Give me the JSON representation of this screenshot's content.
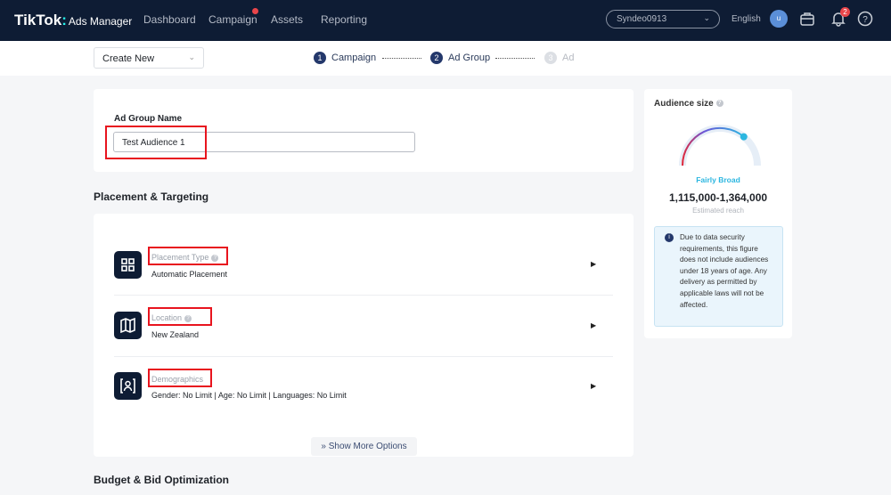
{
  "nav": {
    "logo": "TikTok",
    "logo_sub": "Ads Manager",
    "items": [
      "Dashboard",
      "Campaign",
      "Assets",
      "Reporting"
    ],
    "account": "Syndeo0913",
    "language": "English",
    "avatar_initial": "u",
    "notification_count": "2",
    "accent": "#0e1c34"
  },
  "subheader": {
    "create_new": "Create New",
    "steps": [
      {
        "num": "1",
        "label": "Campaign"
      },
      {
        "num": "2",
        "label": "Ad Group"
      },
      {
        "num": "3",
        "label": "Ad"
      }
    ]
  },
  "ad_group": {
    "name_label": "Ad Group Name",
    "name_value": "Test Audience 1"
  },
  "placement": {
    "section_title": "Placement & Targeting",
    "rows": [
      {
        "title": "Placement Type",
        "value": "Automatic Placement",
        "icon": "grid-icon"
      },
      {
        "title": "Location",
        "value": "New Zealand",
        "icon": "map-icon"
      },
      {
        "title": "Demographics",
        "value": "Gender: No Limit | Age: No Limit | Languages: No Limit",
        "icon": "person-icon"
      }
    ],
    "show_more": "Show More Options"
  },
  "budget": {
    "section_title": "Budget & Bid Optimization"
  },
  "audience": {
    "title": "Audience size",
    "level": "Fairly Broad",
    "range": "1,115,000-1,364,000",
    "range_caption": "Estimated reach",
    "gauge_level_percent": 72,
    "note": "Due to data security requirements, this figure does not include audiences under 18 years of age. Any delivery as permitted by applicable laws will not be affected."
  }
}
